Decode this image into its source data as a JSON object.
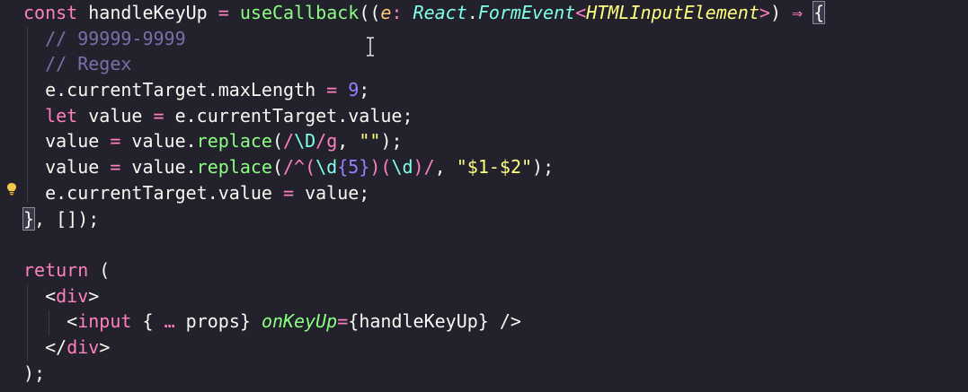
{
  "editor": {
    "theme_colors": {
      "background": "#22212c",
      "keyword": "#ff80bf",
      "function": "#8aff80",
      "comment": "#7970a9",
      "string": "#ffff80",
      "number": "#9580ff",
      "type": "#80ffea"
    },
    "lines": [
      {
        "tokens": [
          {
            "t": "const",
            "c": "kw"
          },
          {
            "t": " handleKeyUp ",
            "c": "var"
          },
          {
            "t": "=",
            "c": "op"
          },
          {
            "t": " ",
            "c": "var"
          },
          {
            "t": "useCallback",
            "c": "fn"
          },
          {
            "t": "((",
            "c": "punct"
          },
          {
            "t": "e",
            "c": "param"
          },
          {
            "t": ": ",
            "c": "op"
          },
          {
            "t": "React",
            "c": "type"
          },
          {
            "t": ".",
            "c": "punct"
          },
          {
            "t": "FormEvent",
            "c": "type"
          },
          {
            "t": "<",
            "c": "op"
          },
          {
            "t": "HTMLInputElement",
            "c": "ptype"
          },
          {
            "t": ">",
            "c": "op"
          },
          {
            "t": ") ",
            "c": "punct"
          },
          {
            "t": "⇒",
            "c": "op"
          },
          {
            "t": " ",
            "c": "var"
          },
          {
            "t": "{",
            "c": "bracket"
          }
        ]
      },
      {
        "tokens": [
          {
            "t": "  ",
            "c": "var"
          },
          {
            "t": "// 99999-9999",
            "c": "comment"
          }
        ]
      },
      {
        "tokens": [
          {
            "t": "  ",
            "c": "var"
          },
          {
            "t": "// Regex",
            "c": "comment"
          }
        ]
      },
      {
        "tokens": [
          {
            "t": "  e.currentTarget.maxLength ",
            "c": "var"
          },
          {
            "t": "=",
            "c": "op"
          },
          {
            "t": " ",
            "c": "var"
          },
          {
            "t": "9",
            "c": "num"
          },
          {
            "t": ";",
            "c": "punct"
          }
        ]
      },
      {
        "tokens": [
          {
            "t": "  ",
            "c": "var"
          },
          {
            "t": "let",
            "c": "kw"
          },
          {
            "t": " value ",
            "c": "var"
          },
          {
            "t": "=",
            "c": "op"
          },
          {
            "t": " e.currentTarget.value;",
            "c": "var"
          }
        ]
      },
      {
        "tokens": [
          {
            "t": "  value ",
            "c": "var"
          },
          {
            "t": "=",
            "c": "op"
          },
          {
            "t": " value.",
            "c": "var"
          },
          {
            "t": "replace",
            "c": "fn"
          },
          {
            "t": "(",
            "c": "punct"
          },
          {
            "t": "/",
            "c": "regex"
          },
          {
            "t": "\\D",
            "c": "regex-esc"
          },
          {
            "t": "/g",
            "c": "regex"
          },
          {
            "t": ", ",
            "c": "punct"
          },
          {
            "t": "\"\"",
            "c": "str"
          },
          {
            "t": ");",
            "c": "punct"
          }
        ]
      },
      {
        "tokens": [
          {
            "t": "  value ",
            "c": "var"
          },
          {
            "t": "=",
            "c": "op"
          },
          {
            "t": " value.",
            "c": "var"
          },
          {
            "t": "replace",
            "c": "fn"
          },
          {
            "t": "(",
            "c": "punct"
          },
          {
            "t": "/^(",
            "c": "regex"
          },
          {
            "t": "\\d",
            "c": "regex-esc"
          },
          {
            "t": "{5}",
            "c": "num"
          },
          {
            "t": ")(",
            "c": "regex"
          },
          {
            "t": "\\d",
            "c": "regex-esc"
          },
          {
            "t": ")/",
            "c": "regex"
          },
          {
            "t": ", ",
            "c": "punct"
          },
          {
            "t": "\"$1-$2\"",
            "c": "str"
          },
          {
            "t": ");",
            "c": "punct"
          }
        ]
      },
      {
        "tokens": [
          {
            "t": "  e.currentTarget.value ",
            "c": "var"
          },
          {
            "t": "=",
            "c": "op"
          },
          {
            "t": " value;",
            "c": "var"
          }
        ]
      },
      {
        "tokens": [
          {
            "t": "}",
            "c": "bracket"
          },
          {
            "t": ", [])",
            "c": "punct"
          },
          {
            "t": ";",
            "c": "punct"
          }
        ]
      },
      {
        "tokens": [
          {
            "t": "",
            "c": "var"
          }
        ]
      },
      {
        "tokens": [
          {
            "t": "return",
            "c": "kw"
          },
          {
            "t": " (",
            "c": "punct"
          }
        ]
      },
      {
        "tokens": [
          {
            "t": "  ",
            "c": "var"
          },
          {
            "t": "<",
            "c": "punct"
          },
          {
            "t": "div",
            "c": "tag"
          },
          {
            "t": ">",
            "c": "punct"
          }
        ]
      },
      {
        "tokens": [
          {
            "t": "    ",
            "c": "var"
          },
          {
            "t": "<",
            "c": "punct"
          },
          {
            "t": "input",
            "c": "tag"
          },
          {
            "t": " { ",
            "c": "punct"
          },
          {
            "t": "…",
            "c": "op"
          },
          {
            "t": " props} ",
            "c": "var"
          },
          {
            "t": "onKeyUp",
            "c": "attr"
          },
          {
            "t": "=",
            "c": "op"
          },
          {
            "t": "{handleKeyUp} ",
            "c": "var"
          },
          {
            "t": "/>",
            "c": "punct"
          }
        ]
      },
      {
        "tokens": [
          {
            "t": "  ",
            "c": "var"
          },
          {
            "t": "</",
            "c": "punct"
          },
          {
            "t": "div",
            "c": "tag"
          },
          {
            "t": ">",
            "c": "punct"
          }
        ]
      },
      {
        "tokens": [
          {
            "t": ");",
            "c": "punct"
          }
        ]
      }
    ]
  },
  "icons": {
    "lightbulb": "lightbulb-icon",
    "cursor": "text-cursor-icon"
  }
}
